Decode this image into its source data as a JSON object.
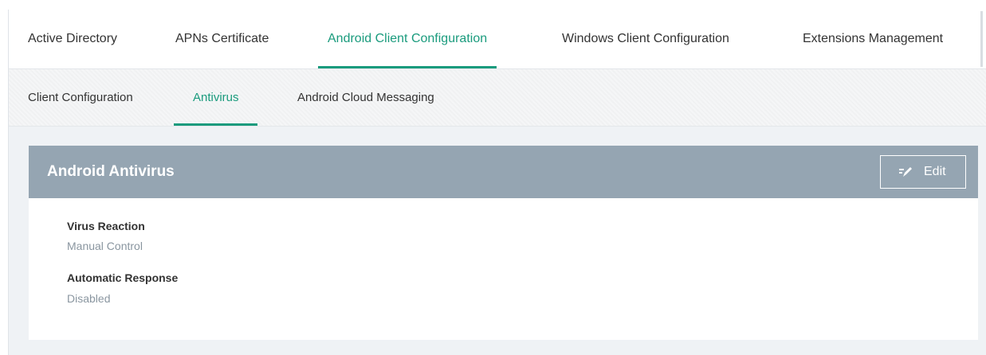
{
  "top_tabs": [
    {
      "label": "Active Directory",
      "active": false
    },
    {
      "label": "APNs Certificate",
      "active": false
    },
    {
      "label": "Android Client Configuration",
      "active": true
    },
    {
      "label": "Windows Client Configuration",
      "active": false
    },
    {
      "label": "Extensions Management",
      "active": false
    }
  ],
  "sub_tabs": [
    {
      "label": "Client Configuration",
      "active": false
    },
    {
      "label": "Antivirus",
      "active": true
    },
    {
      "label": "Android Cloud Messaging",
      "active": false
    }
  ],
  "panel": {
    "title": "Android Antivirus",
    "edit_label": "Edit",
    "edit_icon": "pencil-icon",
    "fields": [
      {
        "label": "Virus Reaction",
        "value": "Manual Control"
      },
      {
        "label": "Automatic Response",
        "value": "Disabled"
      }
    ]
  },
  "colors": {
    "accent": "#1a9b7d",
    "panel_header": "#95a5b2",
    "value_text": "#8a96a0",
    "background": "#eff2f5"
  }
}
